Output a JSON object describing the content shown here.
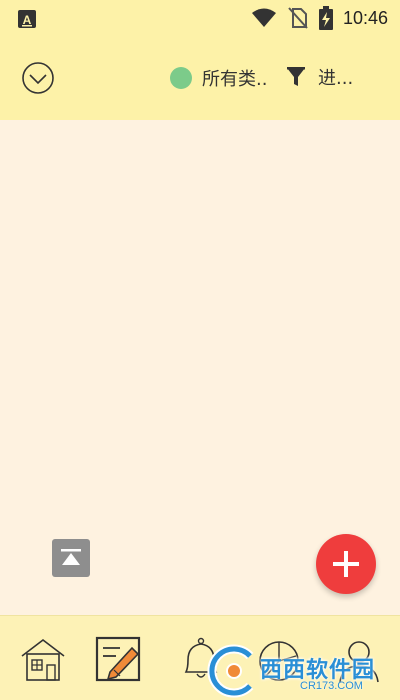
{
  "status_bar": {
    "time": "10:46",
    "icons": [
      "accessibility-icon",
      "wifi-icon",
      "no-sim-icon",
      "battery-charging-icon"
    ]
  },
  "toolbar": {
    "collapse_icon": "chevron-down-circle-icon",
    "category_label": "所有类..",
    "category_color": "#7ccb8a",
    "filter_icon": "funnel-icon",
    "progress_label": "进..."
  },
  "content": {
    "top_button_icon": "scroll-to-top-icon",
    "fab_icon": "plus-icon",
    "fab_color": "#ef3d3d"
  },
  "bottom_nav": {
    "items": [
      {
        "name": "home",
        "icon": "house-icon"
      },
      {
        "name": "notes",
        "icon": "pencil-note-icon",
        "active": true
      },
      {
        "name": "reminders",
        "icon": "bell-icon"
      },
      {
        "name": "stats",
        "icon": "pie-chart-icon"
      },
      {
        "name": "profile",
        "icon": "person-icon"
      }
    ]
  },
  "watermark": {
    "text": "西西软件园",
    "subtext": "CR173.COM"
  }
}
